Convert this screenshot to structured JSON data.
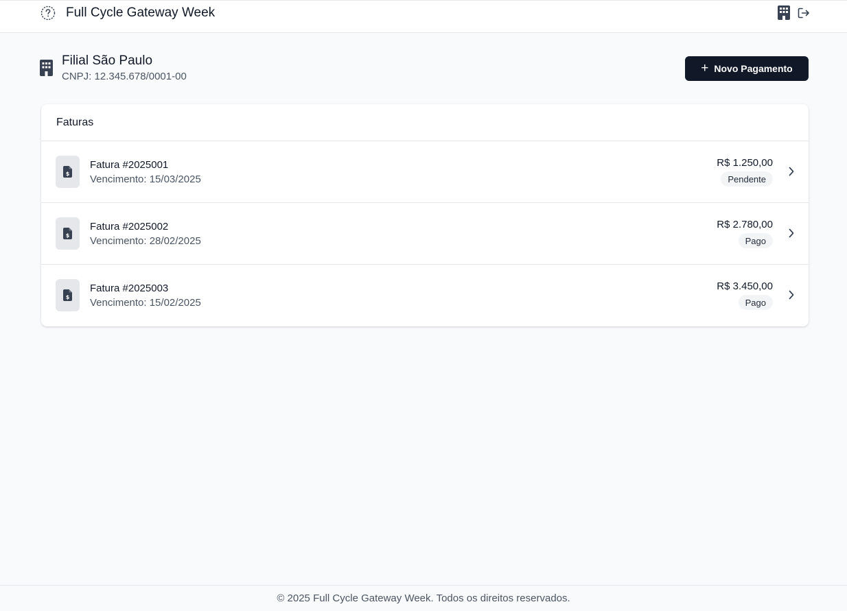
{
  "header": {
    "title": "Full Cycle Gateway Week",
    "icons": [
      "help-circle-icon",
      "building-icon",
      "logout-icon"
    ]
  },
  "branch": {
    "name": "Filial São Paulo",
    "cnpj": "CNPJ: 12.345.678/0001-00",
    "icon": "building-icon"
  },
  "actions": {
    "new_payment_icon": "+",
    "new_payment_label": "Novo Pagamento"
  },
  "invoices": {
    "title": "Faturas",
    "items": [
      {
        "title": "Fatura #2025001",
        "due": "Vencimento: 15/03/2025",
        "amount": "R$ 1.250,00",
        "status": "Pendente",
        "icon": "invoice-dollar-icon"
      },
      {
        "title": "Fatura #2025002",
        "due": "Vencimento: 28/02/2025",
        "amount": "R$ 2.780,00",
        "status": "Pago",
        "icon": "invoice-dollar-icon"
      },
      {
        "title": "Fatura #2025003",
        "due": "Vencimento: 15/02/2025",
        "amount": "R$ 3.450,00",
        "status": "Pago",
        "icon": "invoice-dollar-icon"
      }
    ]
  },
  "footer": {
    "text": "© 2025 Full Cycle Gateway Week. Todos os direitos reservados."
  },
  "colors": {
    "background": "#f9fafb",
    "primary_button": "#111827",
    "text_muted": "#4b5563",
    "border": "#e5e7eb"
  }
}
